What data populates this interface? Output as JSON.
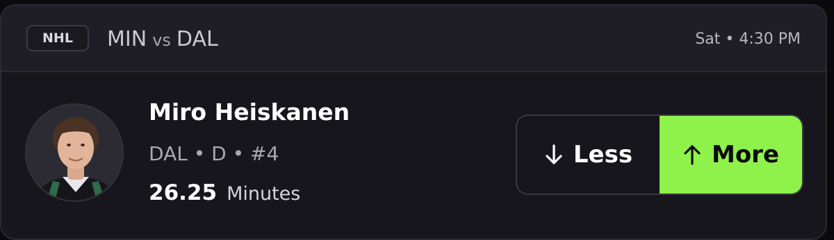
{
  "header": {
    "league": "NHL",
    "team_home": "MIN",
    "vs": "vs",
    "team_away": "DAL",
    "game_time": "Sat • 4:30 PM"
  },
  "player": {
    "name": "Miro Heiskanen",
    "meta": "DAL • D • #4",
    "stat_value": "26.25",
    "stat_label": "Minutes"
  },
  "picks": {
    "less_label": "Less",
    "more_label": "More",
    "less_icon": "arrow-down-icon",
    "more_icon": "arrow-up-icon",
    "more_color": "#8ff24a"
  }
}
